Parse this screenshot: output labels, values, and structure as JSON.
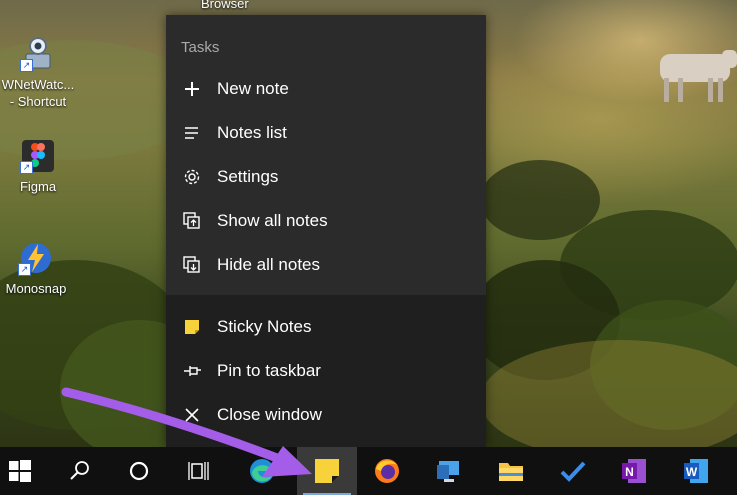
{
  "desktop": {
    "top_partial_label": "Browser",
    "icons": [
      {
        "label_line1": "WNetWatc...",
        "label_line2": "- Shortcut",
        "icon": "network-watcher-icon"
      },
      {
        "label_line1": "Figma",
        "label_line2": "",
        "icon": "figma-icon"
      },
      {
        "label_line1": "Monosnap",
        "label_line2": "",
        "icon": "monosnap-icon"
      }
    ]
  },
  "jumplist": {
    "section_title": "Tasks",
    "tasks": [
      {
        "label": "New note",
        "icon": "plus-icon"
      },
      {
        "label": "Notes list",
        "icon": "list-icon"
      },
      {
        "label": "Settings",
        "icon": "gear-icon"
      },
      {
        "label": "Show all notes",
        "icon": "show-notes-icon"
      },
      {
        "label": "Hide all notes",
        "icon": "hide-notes-icon"
      }
    ],
    "app_actions": [
      {
        "label": "Sticky Notes",
        "icon": "sticky-notes-icon"
      },
      {
        "label": "Pin to taskbar",
        "icon": "pin-icon"
      },
      {
        "label": "Close window",
        "icon": "close-icon"
      }
    ]
  },
  "taskbar": {
    "items": [
      {
        "name": "start-button",
        "icon": "windows-logo-icon"
      },
      {
        "name": "search-button",
        "icon": "search-icon"
      },
      {
        "name": "cortana-button",
        "icon": "cortana-circle-icon"
      },
      {
        "name": "task-view-button",
        "icon": "task-view-icon"
      },
      {
        "name": "edge-button",
        "icon": "edge-icon"
      },
      {
        "name": "sticky-notes-button",
        "icon": "sticky-notes-icon",
        "active": true
      },
      {
        "name": "firefox-button",
        "icon": "firefox-icon"
      },
      {
        "name": "remote-desktop-button",
        "icon": "remote-desktop-icon"
      },
      {
        "name": "file-explorer-button",
        "icon": "folder-icon"
      },
      {
        "name": "todo-button",
        "icon": "checkmark-icon"
      },
      {
        "name": "onenote-button",
        "icon": "onenote-icon"
      },
      {
        "name": "word-button",
        "icon": "word-icon"
      }
    ]
  },
  "colors": {
    "jumplist_bg": "#2b2b2b",
    "jumplist_bottom_bg": "#1f1f1f",
    "taskbar_bg": "#101010",
    "sticky_yellow": "#f7d23a",
    "arrow_purple": "#a45de8",
    "active_underline": "#7aa7d8"
  }
}
